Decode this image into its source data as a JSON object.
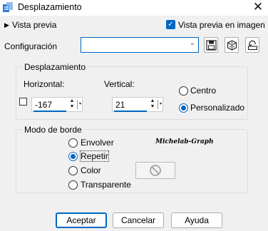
{
  "window": {
    "title": "Desplazamiento",
    "close_glyph": "✕"
  },
  "preview": {
    "toggle_label": "Vista previa",
    "checkbox_label": "Vista previa en imagen",
    "checkbox_checked": true
  },
  "config": {
    "label": "Configuración",
    "value": ""
  },
  "toolbar_icons": [
    "save-icon",
    "randomize-dice-icon",
    "reset-icon"
  ],
  "offset_group": {
    "title": "Desplazamiento",
    "horizontal_label": "Horizontal:",
    "horizontal_value": "-167",
    "vertical_label": "Vertical:",
    "vertical_value": "21",
    "options": [
      {
        "label": "Centro",
        "selected": false
      },
      {
        "label": "Personalizado",
        "selected": true
      }
    ]
  },
  "edge_group": {
    "title": "Modo de borde",
    "options": [
      {
        "label": "Envolver",
        "selected": false
      },
      {
        "label": "Repetir",
        "selected": true
      },
      {
        "label": "Color",
        "selected": false
      },
      {
        "label": "Transparente",
        "selected": false
      }
    ],
    "watermark": "Michelab-Graph"
  },
  "buttons": {
    "ok": "Aceptar",
    "cancel": "Cancelar",
    "help": "Ayuda"
  },
  "colors": {
    "accent": "#0067c0",
    "background": "#f0f0f0"
  }
}
